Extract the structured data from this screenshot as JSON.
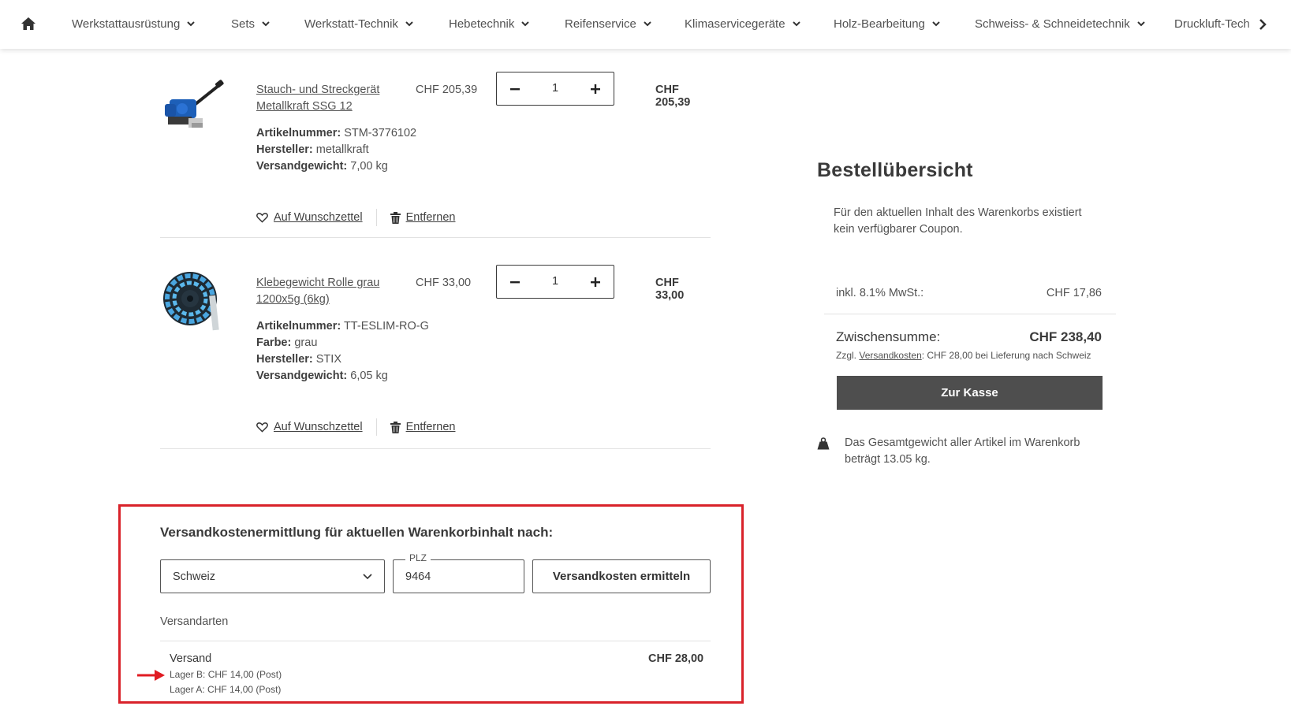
{
  "nav": {
    "home_icon": "home-icon",
    "items": [
      {
        "label": "Werkstattausrüstung"
      },
      {
        "label": "Sets"
      },
      {
        "label": "Werkstatt-Technik"
      },
      {
        "label": "Hebetechnik"
      },
      {
        "label": "Reifenservice"
      },
      {
        "label": "Klimaservicegeräte"
      },
      {
        "label": "Holz-Bearbeitung"
      },
      {
        "label": "Schweiss- & Schneidetechnik"
      },
      {
        "label": "Druckluft-Tech"
      }
    ],
    "next_icon": "chevron-right-icon"
  },
  "cart": {
    "items": [
      {
        "title": "Stauch- und Streckgerät Metallkraft SSG 12",
        "unit_price": "CHF 205,39",
        "quantity": "1",
        "total": "CHF 205,39",
        "attributes": [
          {
            "label": "Artikelnummer:",
            "value": "STM-3776102"
          },
          {
            "label": "Hersteller:",
            "value": "metallkraft"
          },
          {
            "label": "Versandgewicht:",
            "value": "7,00 kg"
          }
        ],
        "wishlist_label": "Auf Wunschzettel",
        "remove_label": "Entfernen"
      },
      {
        "title": "Klebegewicht Rolle grau 1200x5g (6kg)",
        "unit_price": "CHF 33,00",
        "quantity": "1",
        "total": "CHF 33,00",
        "attributes": [
          {
            "label": "Artikelnummer:",
            "value": "TT-ESLIM-RO-G"
          },
          {
            "label": "Farbe:",
            "value": "grau"
          },
          {
            "label": "Hersteller:",
            "value": "STIX"
          },
          {
            "label": "Versandgewicht:",
            "value": "6,05 kg"
          }
        ],
        "wishlist_label": "Auf Wunschzettel",
        "remove_label": "Entfernen"
      }
    ]
  },
  "shipping": {
    "title": "Versandkostenermittlung für aktuellen Warenkorbinhalt nach:",
    "country": "Schweiz",
    "plz_label": "PLZ",
    "plz_value": "9464",
    "calc_button": "Versandkosten ermitteln",
    "methods_label": "Versandarten",
    "method": {
      "name": "Versand",
      "price": "CHF 28,00",
      "details": [
        "Lager B: CHF 14,00 (Post)",
        "Lager A: CHF 14,00 (Post)"
      ]
    },
    "highlight_color": "#d9222a"
  },
  "summary": {
    "title": "Bestellübersicht",
    "coupon_text": "Für den aktuellen Inhalt des Warenkorbs existiert kein verfügbarer Coupon.",
    "vat_label": "inkl. 8.1% MwSt.:",
    "vat_value": "CHF 17,86",
    "subtotal_label": "Zwischensumme:",
    "subtotal_value": "CHF 238,40",
    "shipping_note_prefix": "Zzgl.",
    "shipping_note_link": "Versandkosten",
    "shipping_note_suffix": ": CHF 28,00 bei Lieferung nach Schweiz",
    "checkout_button": "Zur Kasse",
    "weight_text": "Das Gesamtgewicht aller Artikel im Warenkorb beträgt 13.05 kg.",
    "button_color": "#4e4e4e"
  }
}
